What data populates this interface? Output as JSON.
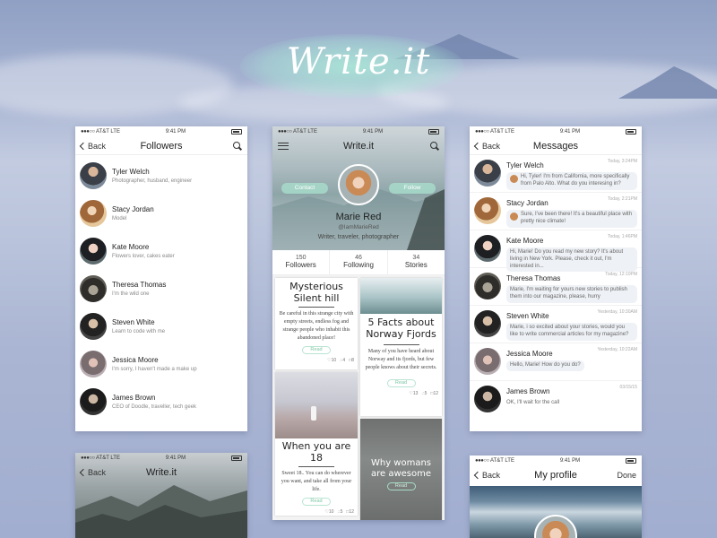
{
  "brand": {
    "logo": "Write.it"
  },
  "status_bar": {
    "carrier": "AT&T LTE",
    "time": "9:41 PM"
  },
  "followers_screen": {
    "back": "Back",
    "title": "Followers",
    "items": [
      {
        "name": "Tyler Welch",
        "subtitle": "Photographer, husband, engineer"
      },
      {
        "name": "Stacy Jordan",
        "subtitle": "Model"
      },
      {
        "name": "Kate Moore",
        "subtitle": "Flowers lover, cakes eater"
      },
      {
        "name": "Theresa Thomas",
        "subtitle": "I'm the wild one"
      },
      {
        "name": "Steven White",
        "subtitle": "Learn to code with me"
      },
      {
        "name": "Jessica Moore",
        "subtitle": "I'm sorry, I haven't made a make up"
      },
      {
        "name": "James Brown",
        "subtitle": "CEO of Doodle, traveller, tech geek"
      }
    ]
  },
  "profile_screen": {
    "title": "Write.it",
    "contact": "Contact",
    "follow": "Follow",
    "name": "Marie Red",
    "handle": "@IamMarieRed",
    "bio": "Writer, traveler, photographer",
    "stats": [
      {
        "num": "150",
        "label": "Followers"
      },
      {
        "num": "46",
        "label": "Following"
      },
      {
        "num": "34",
        "label": "Stories"
      }
    ],
    "stories": {
      "s1": {
        "title": "Mysterious Silent hill",
        "text": "Be careful in this strange city with empty streets, endless fog and strange people who inhabit this abandoned place!",
        "read": "Read",
        "likes": "10",
        "shares": "4",
        "comments": "8"
      },
      "s2": {
        "title": "5 Facts about Norway Fjords",
        "text": "Many of you have heard about Norway and its fjords, but few people knows about their secrets.",
        "read": "Read",
        "likes": "13",
        "shares": "5",
        "comments": "12"
      },
      "s3": {
        "title": "When you are 18",
        "text": "Sweet 18.. You can do wherever you want, and take all from your life.",
        "read": "Read",
        "likes": "10",
        "shares": "5",
        "comments": "12"
      },
      "s4": {
        "title": "Why womans are awesome",
        "read": "Read"
      }
    }
  },
  "messages_screen": {
    "back": "Back",
    "title": "Messages",
    "items": [
      {
        "name": "Tyler Welch",
        "time": "Today, 3:24PM",
        "text": "Hi, Tyler! I'm from California, more specifically from Palo Alto. What do you interesing in?"
      },
      {
        "name": "Stacy Jordan",
        "time": "Today, 2:21PM",
        "text": "Sure, I've been there! It's a beautiful place with pretty nice climate!"
      },
      {
        "name": "Kate Moore",
        "time": "Today, 1:46PM",
        "text": "Hi, Marie! Do you read my new story? It's about living in New York. Please, check it out, I'm interested in..."
      },
      {
        "name": "Theresa Thomas",
        "time": "Today, 12:10PM",
        "text": "Marie, I'm waiting for yours new stories to publish them into our magazine, please, hurry"
      },
      {
        "name": "Steven White",
        "time": "Yesterday, 10:30AM",
        "text": "Marie, i so excited about your stories, would you like to write commercial articles for my magazine?"
      },
      {
        "name": "Jessica Moore",
        "time": "Yesterday, 10:22AM",
        "text": "Hello, Marie! How do you do?"
      },
      {
        "name": "James Brown",
        "time": "03/15/15",
        "text": "OK, I'll wait for the call"
      }
    ]
  },
  "writeit_screen": {
    "back": "Back",
    "title": "Write.it"
  },
  "myprofile_screen": {
    "back": "Back",
    "title": "My profile",
    "done": "Done"
  },
  "colors": {
    "accent": "#7fc7a6",
    "background": "#a9b5d3"
  }
}
